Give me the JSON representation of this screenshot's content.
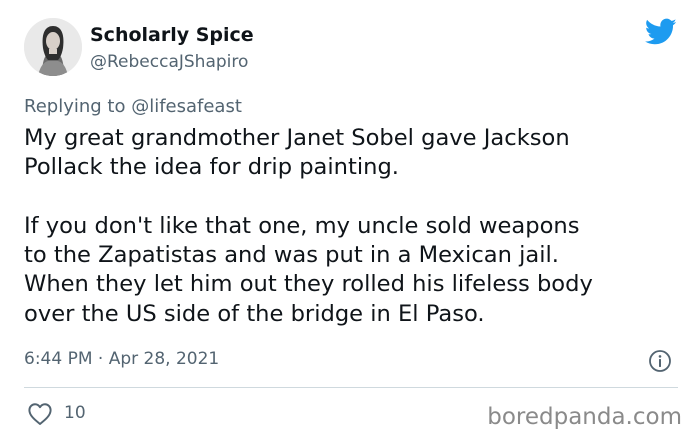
{
  "user": {
    "display_name": "Scholarly Spice",
    "handle": "@RebeccaJShapiro"
  },
  "reply": {
    "prefix": "Replying to ",
    "mention": "@lifesafeast"
  },
  "tweet": {
    "paragraph_1": "My great grandmother Janet Sobel gave Jackson\nPollack the idea for drip painting.",
    "paragraph_2": "If you don't like that one, my uncle sold weapons\nto the Zapatistas and was put in a Mexican jail.\nWhen they let him out they rolled his lifeless body\nover the US side of the bridge in El Paso.",
    "timestamp": "6:44 PM · Apr 28, 2021"
  },
  "engagement": {
    "likes": "10"
  },
  "watermark": "boredpanda.com",
  "icons": {
    "brand": "twitter-bird-icon",
    "info": "info-icon",
    "like": "heart-icon"
  },
  "colors": {
    "twitter_blue": "#1d9bf0",
    "secondary_text": "#536471",
    "divider": "#cfd9de"
  }
}
